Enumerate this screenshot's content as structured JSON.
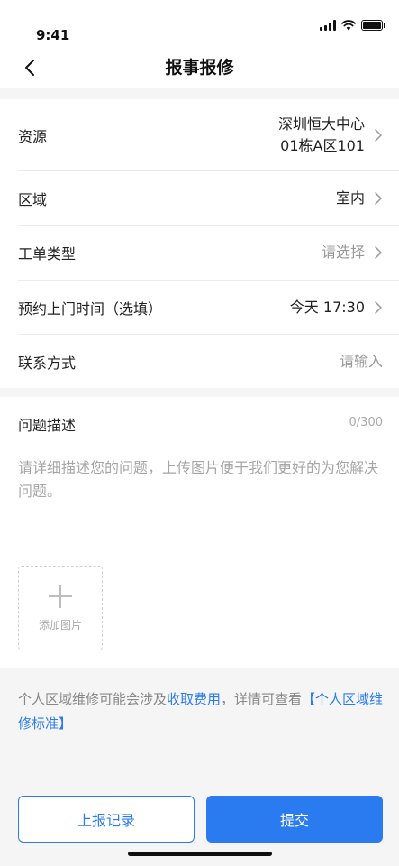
{
  "status_bar": {
    "time": "9:41",
    "icons": [
      "signal-icon",
      "wifi-icon",
      "battery-icon"
    ]
  },
  "nav": {
    "title": "报事报修",
    "back_icon": "chevron-left-icon"
  },
  "form": {
    "resource": {
      "label": "资源",
      "value_line1": "深圳恒大中心",
      "value_line2": "01栋A区101"
    },
    "area": {
      "label": "区域",
      "value": "室内"
    },
    "order_type": {
      "label": "工单类型",
      "placeholder": "请选择"
    },
    "appointment": {
      "label": "预约上门时间（选填）",
      "value": "今天 17:30"
    },
    "contact": {
      "label": "联系方式",
      "placeholder": "请输入"
    }
  },
  "description": {
    "label": "问题描述",
    "count": "0/300",
    "placeholder": "请详细描述您的问题，上传图片便于我们更好的为您解决问题。",
    "add_photo_label": "添加图片"
  },
  "notice": {
    "prefix": "个人区域维修可能会涉及",
    "fee_link": "收取费用",
    "middle": "，详情可查看",
    "standard_link": "【个人区域维修标准】"
  },
  "buttons": {
    "history": "上报记录",
    "submit": "提交"
  },
  "colors": {
    "accent": "#2b7bf0",
    "background": "#f5f5f5",
    "placeholder": "#999999"
  }
}
